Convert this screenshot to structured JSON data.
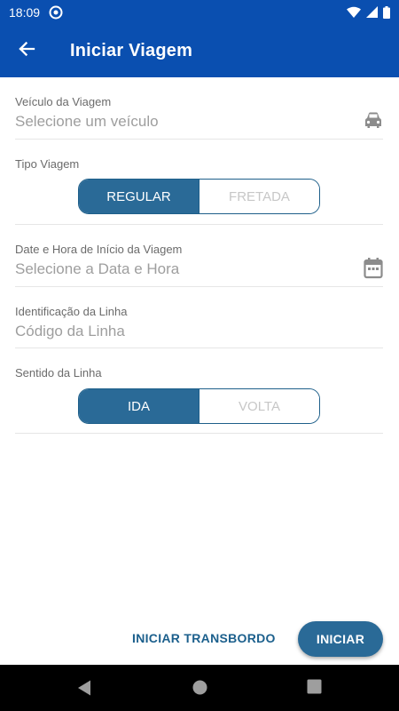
{
  "status_bar": {
    "time": "18:09",
    "icons": [
      "sync-icon",
      "wifi-icon",
      "cellular-icon",
      "battery-icon"
    ]
  },
  "app_bar": {
    "title": "Iniciar Viagem",
    "back_icon": "arrow-left-icon"
  },
  "form": {
    "vehicle": {
      "label": "Veículo da Viagem",
      "placeholder": "Selecione um veículo",
      "icon": "car-icon"
    },
    "trip_type": {
      "label": "Tipo Viagem",
      "options": [
        "REGULAR",
        "FRETADA"
      ],
      "selected": "REGULAR"
    },
    "start_datetime": {
      "label": "Date e Hora de Início da Viagem",
      "placeholder": "Selecione a Data e Hora",
      "icon": "calendar-icon"
    },
    "line_id": {
      "label": "Identificação da Linha",
      "placeholder": "Código da Linha"
    },
    "direction": {
      "label": "Sentido da Linha",
      "options": [
        "IDA",
        "VOLTA"
      ],
      "selected": "IDA"
    }
  },
  "actions": {
    "transfer_label": "INICIAR TRANSBORDO",
    "start_label": "INICIAR"
  },
  "colors": {
    "app_bar": "#0a4fb0",
    "accent": "#2a6a97",
    "text_button": "#1b5f8c"
  },
  "nav_bar": {
    "icons": [
      "back-triangle-icon",
      "home-circle-icon",
      "recents-square-icon"
    ]
  }
}
